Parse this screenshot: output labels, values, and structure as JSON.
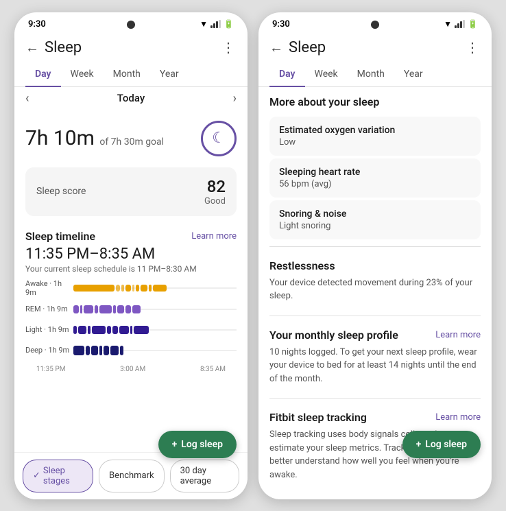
{
  "left_phone": {
    "status_time": "9:30",
    "app_title": "Sleep",
    "tabs": [
      "Day",
      "Week",
      "Month",
      "Year"
    ],
    "active_tab": "Day",
    "date_nav": {
      "prev": "‹",
      "label": "Today",
      "next": "›"
    },
    "sleep_duration": {
      "hours": "7h",
      "minutes": "10m",
      "goal_text": "of 7h 30m goal"
    },
    "sleep_score": {
      "label": "Sleep score",
      "value": "82",
      "quality": "Good"
    },
    "timeline": {
      "section_label": "Sleep timeline",
      "learn_more": "Learn more",
      "time_range": "11:35 PM–8:35 AM",
      "schedule_note": "Your current sleep schedule is 11 PM–8:30 AM"
    },
    "chart_rows": [
      {
        "label": "Awake · 1h 9m"
      },
      {
        "label": "REM · 1h 9m"
      },
      {
        "label": "Light · 1h 9m"
      },
      {
        "label": "Deep · 1h 9m"
      }
    ],
    "chart_time_labels": [
      "11:35 PM",
      "3:00 AM",
      "8:35 AM"
    ],
    "bottom_buttons": [
      {
        "label": "Sleep stages",
        "active": true,
        "check": true
      },
      {
        "label": "Benchmark",
        "active": false
      },
      {
        "label": "30 day average",
        "active": false
      }
    ],
    "log_sleep_fab": "Log sleep"
  },
  "right_phone": {
    "status_time": "9:30",
    "app_title": "Sleep",
    "tabs": [
      "Day",
      "Week",
      "Month",
      "Year"
    ],
    "active_tab": "Day",
    "more_about_header": "More about your sleep",
    "info_cards": [
      {
        "title": "Estimated oxygen variation",
        "value": "Low"
      },
      {
        "title": "Sleeping heart rate",
        "value": "56 bpm (avg)"
      },
      {
        "title": "Snoring & noise",
        "value": "Light snoring"
      }
    ],
    "restlessness": {
      "title": "Restlessness",
      "text": "Your device detected movement during 23% of your sleep."
    },
    "monthly_profile": {
      "title": "Your monthly sleep profile",
      "learn_more": "Learn more",
      "text": "10 nights logged. To get your next sleep profile, wear your device to bed for at least 14 nights until the end of the month."
    },
    "fitbit_tracking": {
      "title": "Fitbit sleep tracking",
      "learn_more": "Learn more",
      "text": "Sleep tracking uses body signals collected to estimate your sleep metrics. Tracking helps you better understand how well you feel when you're awake."
    },
    "log_sleep_fab": "Log sleep"
  }
}
